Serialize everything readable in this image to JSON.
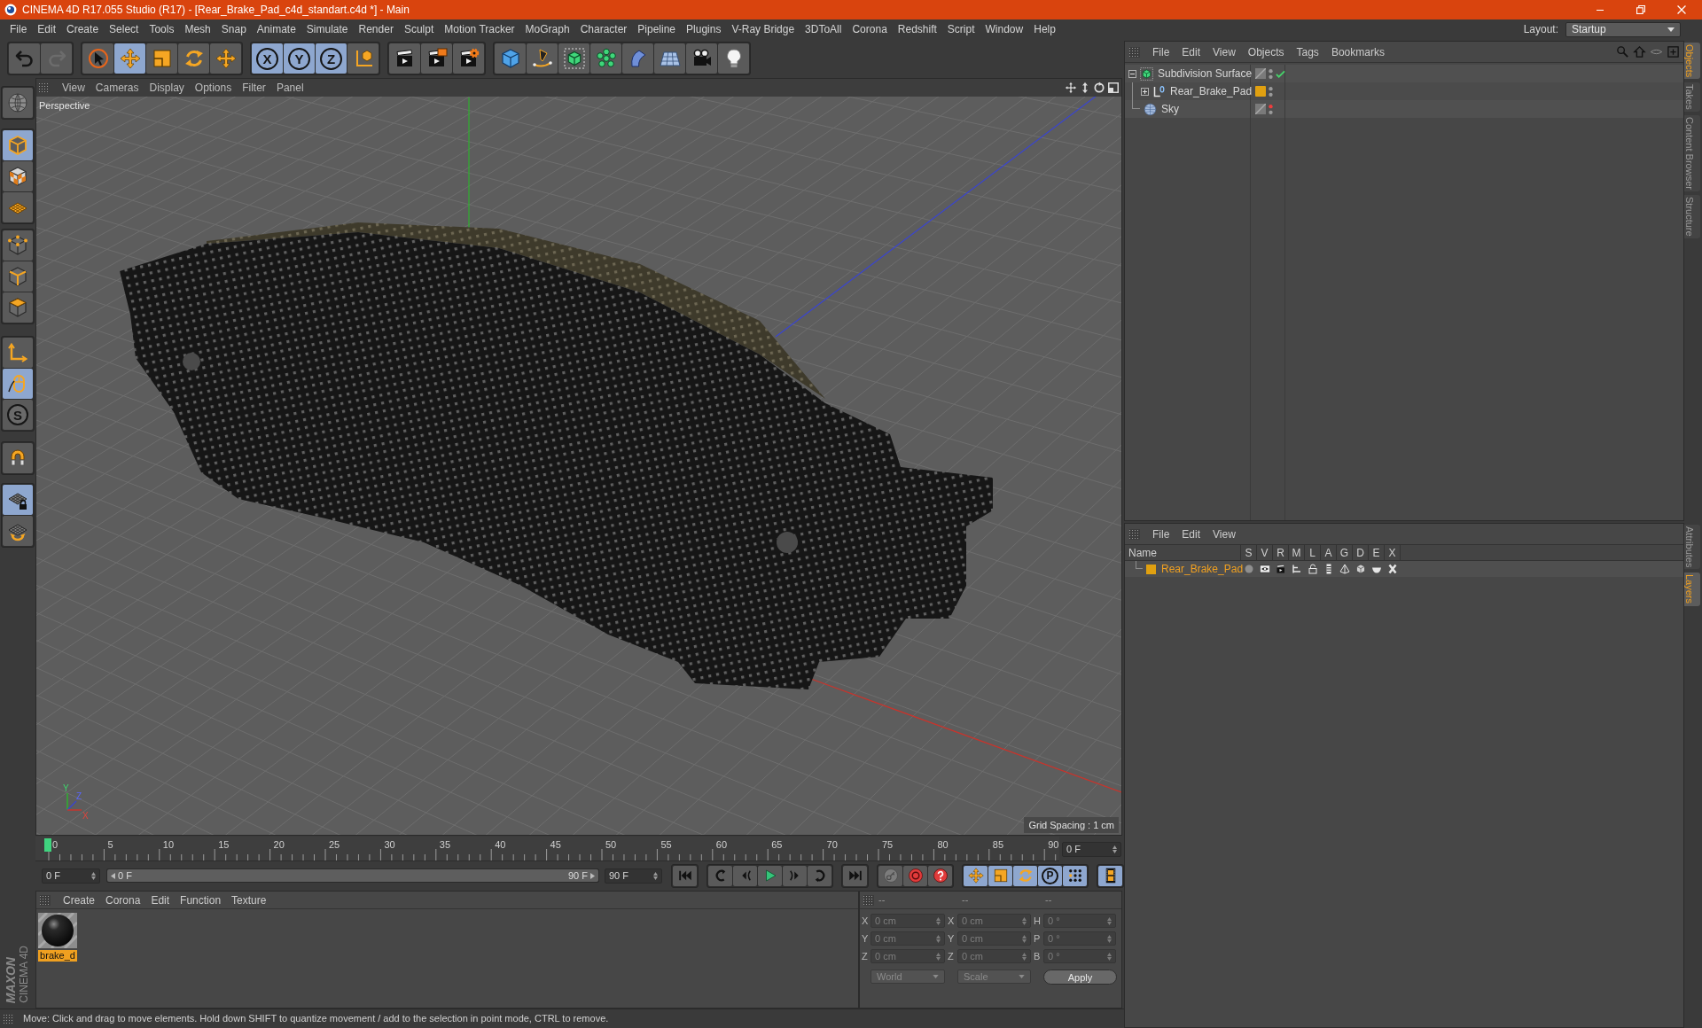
{
  "window": {
    "title": "CINEMA 4D R17.055 Studio (R17) - [Rear_Brake_Pad_c4d_standart.c4d *] - Main"
  },
  "menu_bar": {
    "items": [
      "File",
      "Edit",
      "Create",
      "Select",
      "Tools",
      "Mesh",
      "Snap",
      "Animate",
      "Simulate",
      "Render",
      "Sculpt",
      "Motion Tracker",
      "MoGraph",
      "Character",
      "Pipeline",
      "Plugins",
      "V-Ray Bridge",
      "3DToAll",
      "Corona",
      "Redshift",
      "Script",
      "Window",
      "Help"
    ],
    "layout_label": "Layout:",
    "layout_value": "Startup"
  },
  "toolbar": [
    {
      "selected": false
    },
    {
      "selected": false
    },
    {
      "selected": false
    },
    {
      "selected": true
    },
    {
      "selected": false
    },
    {
      "selected": false
    },
    {
      "selected": false
    },
    {
      "selected": true,
      "label": "X"
    },
    {
      "selected": true,
      "label": "Y"
    },
    {
      "selected": true,
      "label": "Z"
    },
    {
      "selected": false
    },
    {
      "selected": false
    },
    {
      "selected": false
    },
    {
      "selected": false
    },
    {
      "selected": false
    },
    {
      "selected": false
    },
    {
      "selected": false
    },
    {
      "selected": false
    },
    {
      "selected": false
    },
    {
      "selected": false
    },
    {
      "selected": false
    },
    {
      "selected": false
    }
  ],
  "left_toolbar": [
    {
      "selected": false
    },
    {
      "selected": true
    },
    {
      "selected": false
    },
    {
      "selected": false
    },
    {
      "selected": false
    },
    {
      "selected": false
    },
    {
      "selected": false
    },
    {
      "selected": false
    },
    {
      "selected": true
    },
    {
      "selected": false,
      "label": "S"
    },
    {
      "selected": false
    },
    {
      "selected": true
    },
    {
      "selected": false
    }
  ],
  "viewport": {
    "menu": [
      "View",
      "Cameras",
      "Display",
      "Options",
      "Filter",
      "Panel"
    ],
    "camera": "Perspective",
    "axis_labels": [
      "Y",
      "Z",
      "X"
    ],
    "grid_spacing": "Grid Spacing : 1 cm"
  },
  "timeline": {
    "ticks": [
      "0",
      "5",
      "10",
      "15",
      "20",
      "25",
      "30",
      "35",
      "40",
      "45",
      "50",
      "55",
      "60",
      "65",
      "70",
      "75",
      "80",
      "85",
      "90"
    ],
    "current_frame": "0 F",
    "start_frame": "0 F",
    "range_slider": {
      "start": "0 F",
      "end": "90 F",
      "level": 1
    },
    "end_frame": "90 F"
  },
  "transport": [
    {
      "selected": false
    },
    {
      "selected": false
    },
    {
      "selected": false
    },
    {
      "selected": false
    },
    {
      "selected": false
    },
    {
      "selected": false
    },
    {
      "selected": false
    },
    {
      "selected": false
    },
    {
      "selected": false
    },
    {
      "selected": false
    },
    {
      "selected": true
    },
    {
      "selected": true
    },
    {
      "selected": true
    },
    {
      "selected": true,
      "label": "P"
    },
    {
      "selected": true
    },
    {
      "selected": true
    }
  ],
  "material_manager": {
    "menu": [
      "Create",
      "Corona",
      "Edit",
      "Function",
      "Texture"
    ],
    "materials": [
      {
        "name": "brake_d",
        "selected": true
      }
    ]
  },
  "coordinates": {
    "headers": [
      "--",
      "--",
      "--"
    ],
    "rows": [
      {
        "position_axis": "X",
        "position": "0 cm",
        "size_axis": "X",
        "size": "0 cm",
        "rotation_axis": "H",
        "rotation": "0 °"
      },
      {
        "position_axis": "Y",
        "position": "0 cm",
        "size_axis": "Y",
        "size": "0 cm",
        "rotation_axis": "P",
        "rotation": "0 °"
      },
      {
        "position_axis": "Z",
        "position": "0 cm",
        "size_axis": "Z",
        "size": "0 cm",
        "rotation_axis": "B",
        "rotation": "0 °"
      }
    ],
    "coordinate_mode": "World",
    "size_mode": "Scale",
    "apply": "Apply"
  },
  "status_bar": "Move: Click and drag to move elements. Hold down SHIFT to quantize movement / add to the selection in point mode, CTRL to remove.",
  "logo": {
    "brand": "MAXON",
    "product": "CINEMA 4D"
  },
  "object_manager": {
    "menu": [
      "File",
      "Edit",
      "View",
      "Objects",
      "Tags",
      "Bookmarks"
    ],
    "objects": [
      {
        "kind": "subdivision",
        "name": "Subdivision Surface",
        "expanded": true,
        "editor_visible": true,
        "checked": true,
        "children": [
          {
            "kind": "polygon",
            "name": "Rear_Brake_Pad",
            "expanded": false,
            "color": "#e0a010",
            "editor_visible": true,
            "checked": false
          }
        ]
      },
      {
        "kind": "sky",
        "name": "Sky",
        "editor_visible": false,
        "checked": false
      }
    ]
  },
  "layer_manager": {
    "menu": [
      "File",
      "Edit",
      "View"
    ],
    "columns": [
      "Name",
      "S",
      "V",
      "R",
      "M",
      "L",
      "A",
      "G",
      "D",
      "E",
      "X"
    ],
    "layers": [
      {
        "name": "Rear_Brake_Pad",
        "color": "#e0a010",
        "selected": true
      }
    ]
  },
  "side_tabs": {
    "upper": [
      {
        "label": "Objects",
        "selected": true
      },
      {
        "label": "Takes",
        "selected": false
      },
      {
        "label": "Content Browser",
        "selected": false
      },
      {
        "label": "Structure",
        "selected": false
      }
    ],
    "lower": [
      {
        "label": "Attributes",
        "selected": false
      },
      {
        "label": "Layers",
        "selected": true
      }
    ]
  }
}
